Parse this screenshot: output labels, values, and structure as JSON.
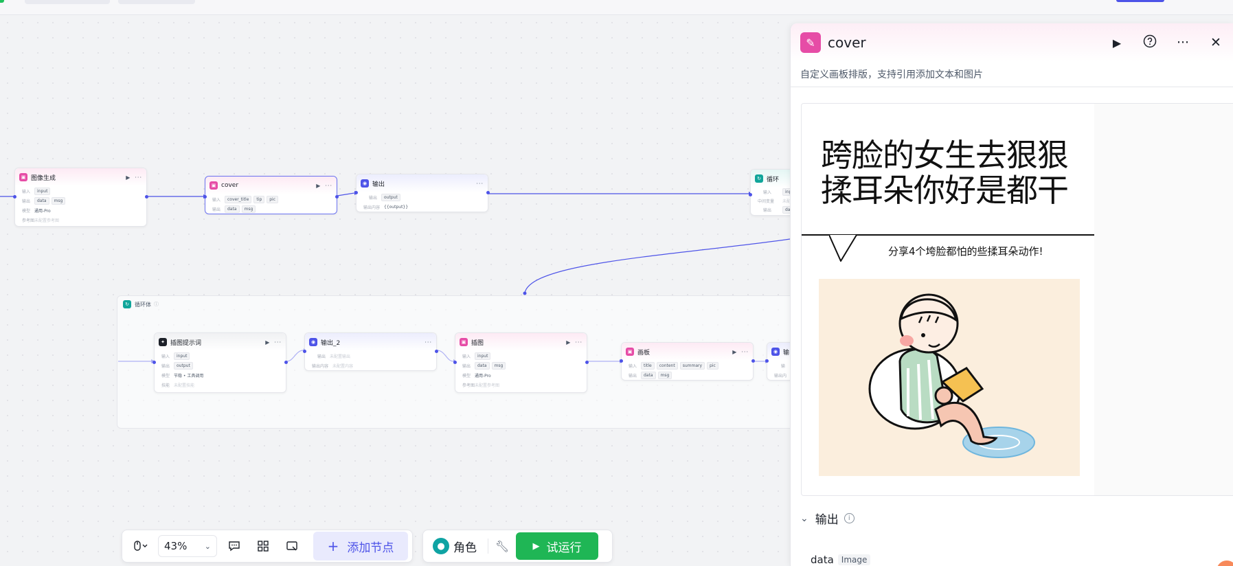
{
  "canvas": {
    "nodes": {
      "image_gen": {
        "title": "图像生成",
        "rows": [
          {
            "label": "输入",
            "chips": [
              "input"
            ]
          },
          {
            "label": "输出",
            "chips": [
              "data",
              "msg"
            ]
          },
          {
            "label": "模型",
            "chips": [
              "通用-Pro"
            ]
          },
          {
            "label": "参考图",
            "text": "未配置参考图"
          }
        ]
      },
      "cover": {
        "title": "cover",
        "rows": [
          {
            "label": "输入",
            "chips": [
              "cover_title",
              "tip",
              "pic"
            ]
          },
          {
            "label": "输出",
            "chips": [
              "data",
              "msg"
            ]
          }
        ]
      },
      "output": {
        "title": "输出",
        "rows": [
          {
            "label": "输出",
            "chips": [
              "output"
            ]
          },
          {
            "label": "输出内容",
            "text": "{{output}}"
          }
        ]
      },
      "loop": {
        "title": "循环",
        "rows": [
          {
            "label": "输入",
            "chips": [
              "inp"
            ]
          },
          {
            "label": "中间变量",
            "text": "未配置"
          },
          {
            "label": "输出",
            "chips": [
              "dat"
            ]
          }
        ]
      },
      "loop_body": {
        "title": "循环体"
      },
      "prompt": {
        "title": "插图提示词",
        "rows": [
          {
            "label": "输入",
            "chips": [
              "input"
            ]
          },
          {
            "label": "输出",
            "chips": [
              "output"
            ]
          },
          {
            "label": "模型",
            "chips": [
              "节稳 • 工具调用"
            ]
          },
          {
            "label": "技能",
            "text": "未配置技能"
          }
        ]
      },
      "output2": {
        "title": "输出_2",
        "rows": [
          {
            "label": "输出",
            "text": "未配置输出"
          },
          {
            "label": "输出内容",
            "text": "未配置内容"
          }
        ]
      },
      "illustration": {
        "title": "插图",
        "rows": [
          {
            "label": "输入",
            "chips": [
              "input"
            ]
          },
          {
            "label": "输出",
            "chips": [
              "data",
              "msg"
            ]
          },
          {
            "label": "模型",
            "chips": [
              "通用-Pro"
            ]
          },
          {
            "label": "参考图",
            "text": "未配置参考图"
          }
        ]
      },
      "board": {
        "title": "画板",
        "rows": [
          {
            "label": "输入",
            "chips": [
              "title",
              "content",
              "summary",
              "pic"
            ]
          },
          {
            "label": "输出",
            "chips": [
              "data",
              "msg"
            ]
          }
        ]
      },
      "output3": {
        "title": "输",
        "rows": [
          {
            "label": "输",
            "text": ""
          },
          {
            "label": "输出内",
            "text": ""
          }
        ]
      }
    }
  },
  "toolbar": {
    "zoom": "43%",
    "add_node": "添加节点",
    "role": "角色",
    "run": "试运行"
  },
  "panel": {
    "title": "cover",
    "description": "自定义画板排版，支持引用添加文本和图片",
    "preview": {
      "title_line1": "跨脸的女生去狠狠",
      "title_line2": "揉耳朵你好是都干",
      "subtitle": "分享4个垮脸都怕的些揉耳朵动作!"
    },
    "output_section": "输出",
    "output_var": "data",
    "output_type": "Image"
  },
  "colors": {
    "accent": "#4d53e8",
    "brand_pink": "#e64ca6",
    "run_green": "#1fb655",
    "loop_teal": "#10a59a"
  }
}
